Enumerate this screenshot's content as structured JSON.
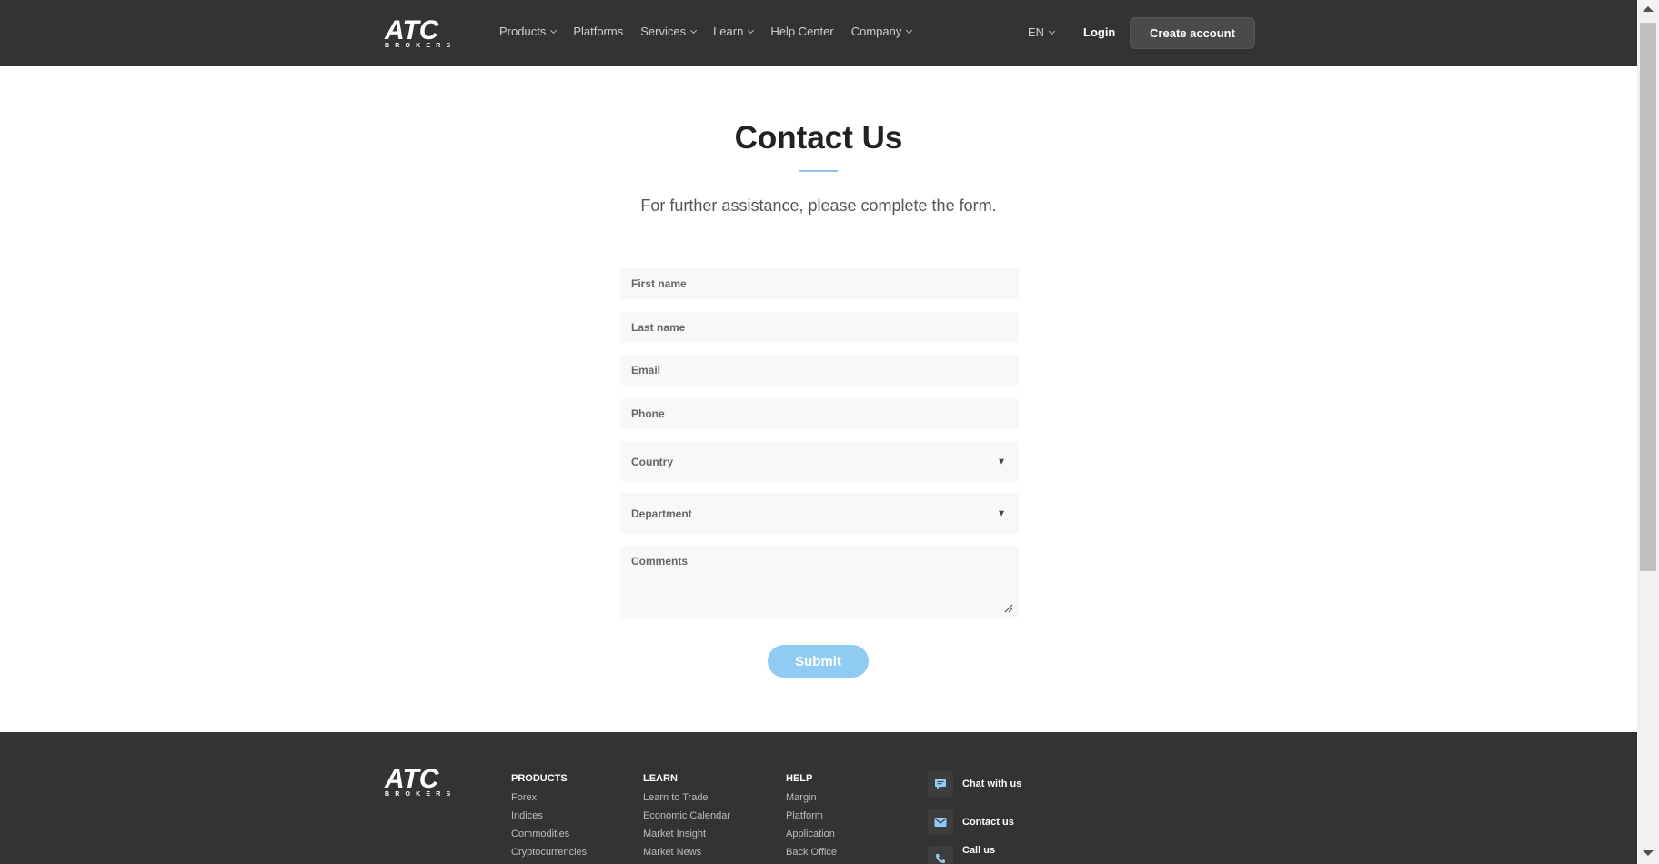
{
  "header": {
    "logo": {
      "main": "ATC",
      "sub": "BROKERS"
    },
    "nav": [
      {
        "label": "Products",
        "dropdown": true
      },
      {
        "label": "Platforms",
        "dropdown": false
      },
      {
        "label": "Services",
        "dropdown": true
      },
      {
        "label": "Learn",
        "dropdown": true
      },
      {
        "label": "Help Center",
        "dropdown": false
      },
      {
        "label": "Company",
        "dropdown": true
      }
    ],
    "language": "EN",
    "login_label": "Login",
    "create_account_label": "Create account"
  },
  "main": {
    "title": "Contact Us",
    "subtitle": "For further assistance, please complete the form.",
    "form": {
      "first_name_placeholder": "First name",
      "last_name_placeholder": "Last name",
      "email_placeholder": "Email",
      "phone_placeholder": "Phone",
      "country_placeholder": "Country",
      "department_placeholder": "Department",
      "comments_placeholder": "Comments",
      "submit_label": "Submit"
    }
  },
  "footer": {
    "logo": {
      "main": "ATC",
      "sub": "BROKERS"
    },
    "columns": [
      {
        "heading": "PRODUCTS",
        "links": [
          "Forex",
          "Indices",
          "Commodities",
          "Cryptocurrencies"
        ]
      },
      {
        "heading": "LEARN",
        "links": [
          "Learn to Trade",
          "Economic Calendar",
          "Market Insight",
          "Market News"
        ]
      },
      {
        "heading": "HELP",
        "links": [
          "Margin",
          "Platform",
          "Application",
          "Back Office"
        ]
      }
    ],
    "contacts": [
      {
        "label": "Chat with us",
        "icon": "chat-icon"
      },
      {
        "label": "Contact us",
        "icon": "mail-icon"
      },
      {
        "label": "Call us",
        "icon": "phone-icon"
      }
    ]
  },
  "colors": {
    "header_bg": "#333333",
    "accent": "#8fcbf2",
    "field_bg": "#f8f8f8"
  }
}
